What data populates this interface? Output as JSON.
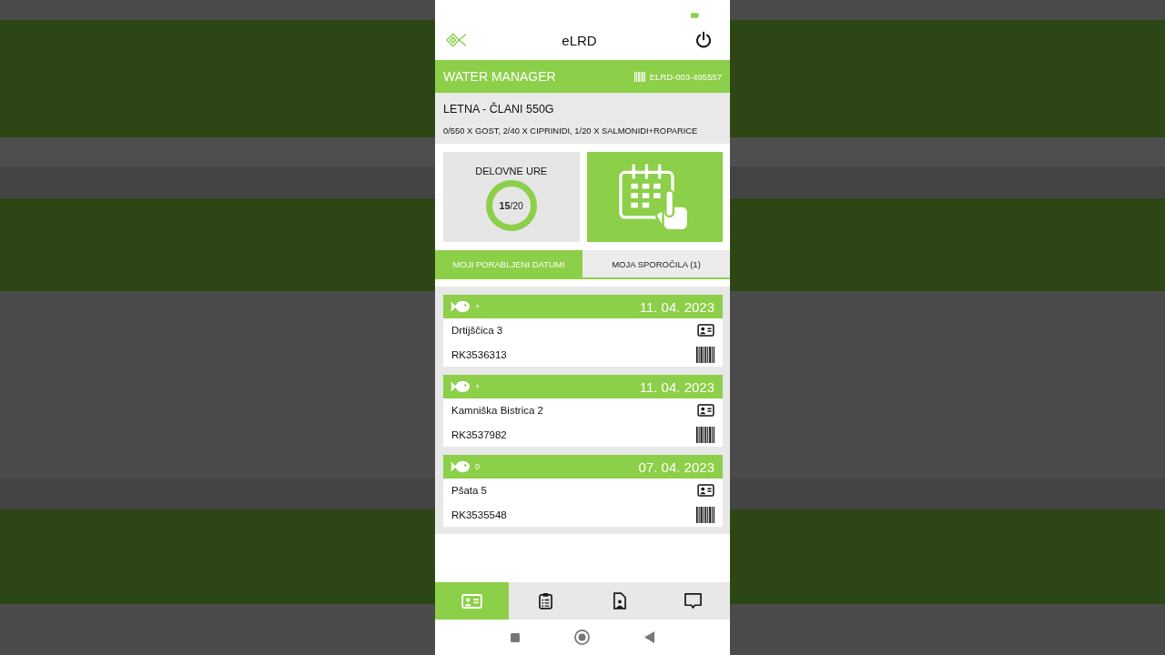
{
  "header": {
    "title": "eLRD"
  },
  "account_bar": {
    "title": "WATER MANAGER",
    "code": "ELRD-003-495557"
  },
  "license": {
    "name": "LETNA - ČLANI 550G",
    "quota": "0/550 X GOST, 2/40 X CIPRINIDI, 1/20 X SALMONIDI+ROPARICE"
  },
  "tiles": [
    {
      "kind": "counter",
      "label": "DELOVNE URE",
      "count": "**15**/20"
    },
    {
      "kind": "calendar"
    }
  ],
  "tabs": [
    {
      "label": "MOJI PORABLJENI DATUMI",
      "selected": true
    },
    {
      "label": "MOJA SPOROČILA (1)",
      "selected": false
    }
  ],
  "entries": [
    {
      "catch_mark": "+",
      "date": "11. 04. 2023",
      "location": "Drtijščica 3",
      "code": "RK3536313"
    },
    {
      "catch_mark": "+",
      "date": "11. 04. 2023",
      "location": "Kamniška Bistrica 2",
      "code": "RK3537982"
    },
    {
      "catch_mark": "0",
      "date": "07. 04. 2023",
      "location": "Pšata 5",
      "code": "RK3535548"
    }
  ],
  "bottom_nav": [
    {
      "kind": "card",
      "selected": true
    },
    {
      "kind": "checklist",
      "selected": false
    },
    {
      "kind": "profile",
      "selected": false
    },
    {
      "kind": "chat",
      "selected": false
    }
  ]
}
